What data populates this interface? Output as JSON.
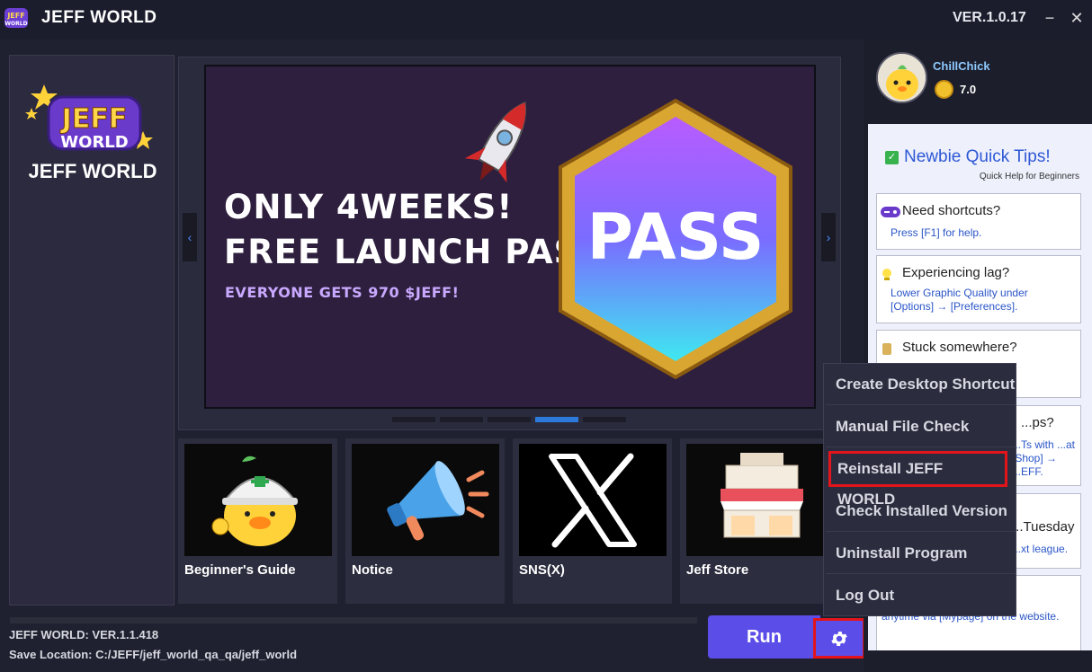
{
  "titlebar": {
    "title": "JEFF WORLD",
    "version": "VER.1.0.17",
    "minimize_glyph": "−",
    "close_glyph": "✕"
  },
  "sidebar": {
    "name": "JEFF WORLD",
    "logo_top": "JEFF",
    "logo_bottom": "WORLD"
  },
  "banner": {
    "line1": "ONLY 4WEEKS!",
    "line2": "FREE LAUNCH PASS",
    "subline": "EVERYONE GETS 970 $JEFF!",
    "pass_word": "PASS",
    "prev_glyph": "‹",
    "next_glyph": "›",
    "dot_count": 5,
    "active_dot_index": 3
  },
  "tiles": [
    {
      "label": "Beginner's Guide",
      "icon": "chick-hardhat-icon"
    },
    {
      "label": "Notice",
      "icon": "megaphone-icon"
    },
    {
      "label": "SNS(X)",
      "icon": "x-logo-icon"
    },
    {
      "label": "Jeff Store",
      "icon": "store-icon"
    }
  ],
  "footer": {
    "version_line": "JEFF WORLD: VER.1.1.418",
    "save_location": "Save Location: C:/JEFF/jeff_world_qa_qa/jeff_world",
    "run_label": "Run",
    "progress": 0
  },
  "user": {
    "name": "ChillChick",
    "coins": "7.0"
  },
  "tips": {
    "title": "Newbie Quick Tips!",
    "subtitle": "Quick Help for Beginners",
    "items": [
      {
        "title": "Need shortcuts?",
        "body": "Press [F1] for help.",
        "icon": "gamepad-icon"
      },
      {
        "title": "Experiencing lag?",
        "body": "Lower Graphic Quality under [Options] → [Preferences].",
        "icon": "lightbulb-icon"
      },
      {
        "title": "Stuck somewhere?",
        "body": "",
        "icon": "map-icon"
      },
      {
        "title": "...ps?",
        "body": "...Ts with ...at [Shop] → ...EFF.",
        "icon": ""
      },
      {
        "title": "...Tuesday",
        "body": "...xt league.",
        "icon": ""
      },
      {
        "title": "",
        "body": "anytime via [Mypage] on the website.",
        "icon": ""
      }
    ]
  },
  "menu": {
    "items": [
      "Create Desktop Shortcut",
      "Manual File Check",
      "Reinstall JEFF WORLD",
      "Check Installed Version",
      "Uninstall Program",
      "Log Out"
    ],
    "highlighted_index": 2
  },
  "colors": {
    "accent": "#5b4de8",
    "highlight_border": "#e3141b",
    "link": "#2a55c8",
    "tips_title": "#2e58d6"
  }
}
